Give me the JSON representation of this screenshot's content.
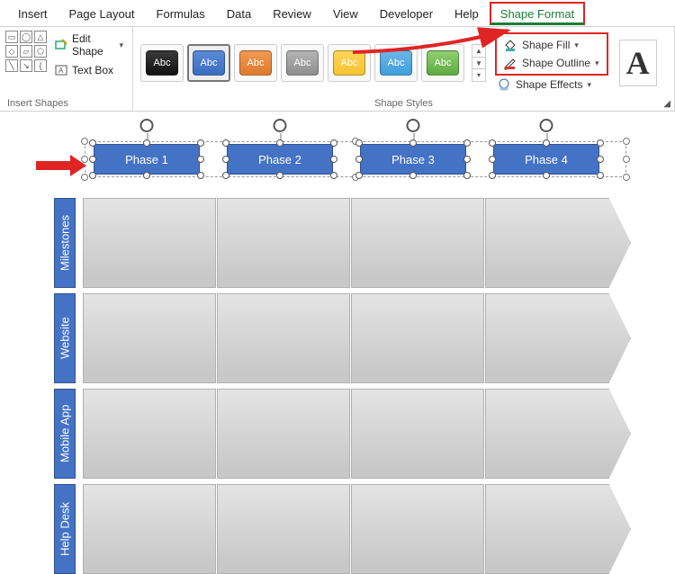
{
  "ribbon": {
    "tabs": [
      "Insert",
      "Page Layout",
      "Formulas",
      "Data",
      "Review",
      "View",
      "Developer",
      "Help",
      "Shape Format"
    ],
    "active_tab": "Shape Format",
    "insert_shapes": {
      "group_label": "Insert Shapes",
      "edit_shape": "Edit Shape",
      "text_box": "Text Box"
    },
    "shape_styles": {
      "group_label": "Shape Styles",
      "swatch_label": "Abc",
      "colors": [
        {
          "name": "black",
          "c1": "#3a3a3a",
          "c2": "#111"
        },
        {
          "name": "blue",
          "c1": "#5b8bd6",
          "c2": "#3a6cc0",
          "selected": true
        },
        {
          "name": "orange",
          "c1": "#ef9a55",
          "c2": "#e07a2a"
        },
        {
          "name": "gray",
          "c1": "#b4b4b4",
          "c2": "#8e8e8e"
        },
        {
          "name": "yellow",
          "c1": "#ffd659",
          "c2": "#f6c22f"
        },
        {
          "name": "lightblue",
          "c1": "#6db6e8",
          "c2": "#3f9fdb"
        },
        {
          "name": "green",
          "c1": "#8fcf73",
          "c2": "#5fab3e"
        }
      ],
      "shape_fill": "Shape Fill",
      "shape_outline": "Shape Outline",
      "shape_effects": "Shape Effects"
    }
  },
  "phases": [
    "Phase 1",
    "Phase 2",
    "Phase 3",
    "Phase 4"
  ],
  "rows": [
    "Milestones",
    "Website",
    "Mobile App",
    "Help Desk"
  ],
  "columns_per_row": 4
}
